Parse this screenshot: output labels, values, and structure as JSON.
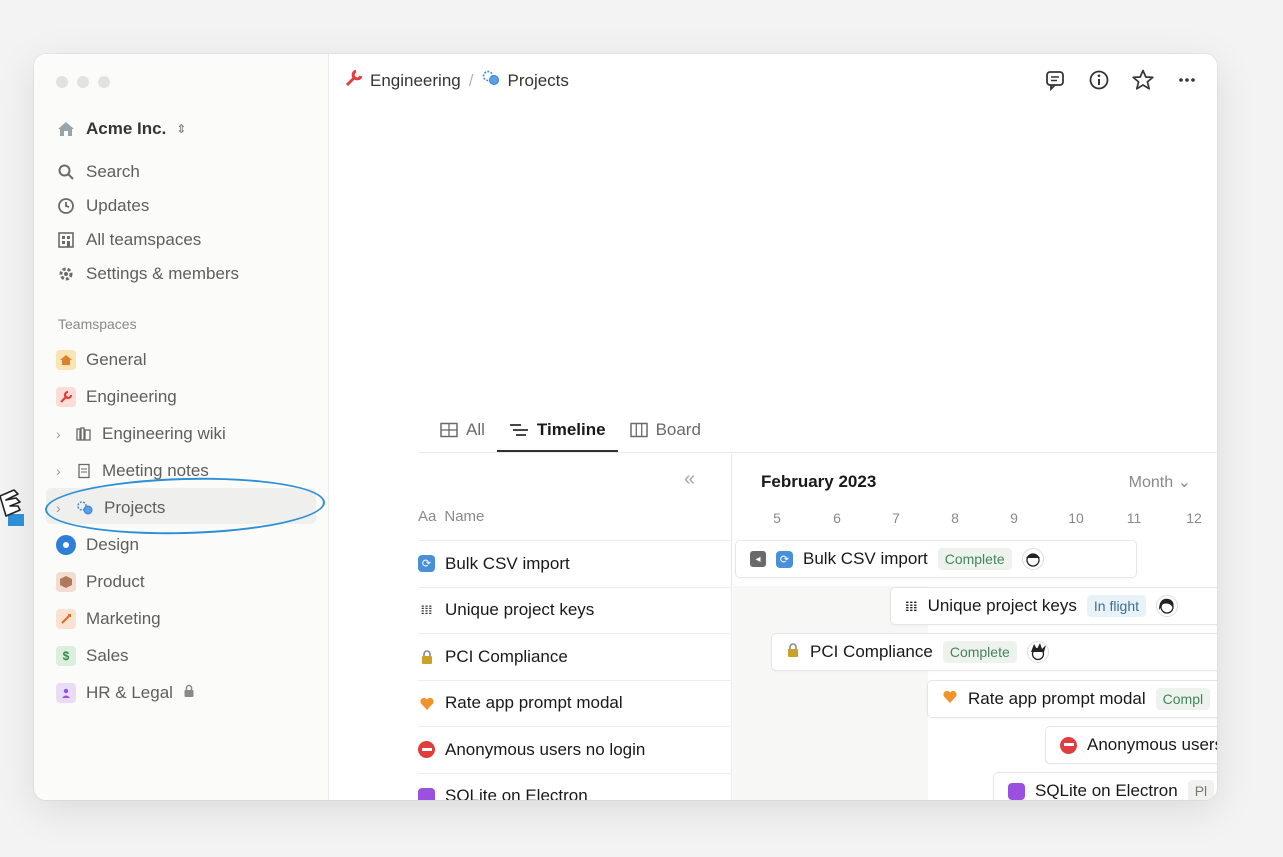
{
  "workspace": {
    "name": "Acme Inc.",
    "switcher_icon": "chevron-updown-icon"
  },
  "sidebar": {
    "nav": [
      {
        "label": "Search",
        "icon": "search-icon"
      },
      {
        "label": "Updates",
        "icon": "clock-icon"
      },
      {
        "label": "All teamspaces",
        "icon": "building-icon"
      },
      {
        "label": "Settings & members",
        "icon": "gear-icon"
      }
    ],
    "section_label": "Teamspaces",
    "teamspaces": [
      {
        "label": "General",
        "color": "#fbe3b3"
      },
      {
        "label": "Engineering",
        "color": "#fbdcd6"
      },
      {
        "label": "Engineering wiki"
      },
      {
        "label": "Meeting notes"
      },
      {
        "label": "Projects"
      },
      {
        "label": "Design",
        "color": "#2f7fd8"
      },
      {
        "label": "Product",
        "color": "#f3ddd3"
      },
      {
        "label": "Marketing",
        "color": "#fbe1cf"
      },
      {
        "label": "Sales",
        "color": "#dcefdc"
      },
      {
        "label": "HR & Legal",
        "color": "#eadcf5"
      }
    ]
  },
  "breadcrumb": {
    "parent": "Engineering",
    "separator": "/",
    "current": "Projects"
  },
  "views": {
    "tabs": [
      "All",
      "Timeline",
      "Board"
    ],
    "active": "Timeline"
  },
  "table": {
    "column_prefix": "Aa",
    "column_name": "Name",
    "rows": [
      {
        "name": "Bulk CSV import",
        "icon_color": "#4a90d9"
      },
      {
        "name": "Unique project keys",
        "icon_color": "#37352f"
      },
      {
        "name": "PCI Compliance",
        "icon_color": "#c9a227"
      },
      {
        "name": "Rate app prompt modal",
        "icon_color": "#f0932b"
      },
      {
        "name": "Anonymous users no login",
        "icon_color": "#e03e3e"
      },
      {
        "name": "SQLite on Electron",
        "icon_color": "#9b51e0"
      }
    ]
  },
  "timeline": {
    "month": "February 2023",
    "zoom": "Month",
    "days": [
      "5",
      "6",
      "7",
      "8",
      "9",
      "10",
      "11",
      "12"
    ],
    "bars": [
      {
        "name": "Bulk CSV import",
        "status": "Complete"
      },
      {
        "name": "Unique project keys",
        "status": "In flight"
      },
      {
        "name": "PCI Compliance",
        "status": "Complete"
      },
      {
        "name": "Rate app prompt modal",
        "status": "Compl"
      },
      {
        "name": "Anonymous users",
        "status": ""
      },
      {
        "name": "SQLite on Electron",
        "status": "Pl"
      }
    ]
  }
}
